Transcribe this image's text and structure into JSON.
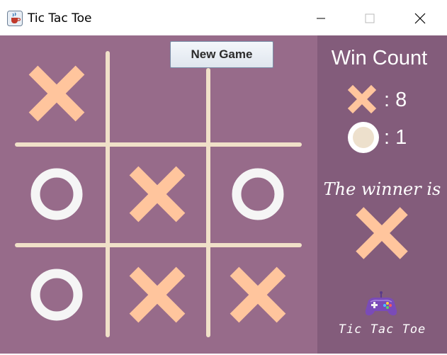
{
  "window": {
    "title": "Tic Tac Toe",
    "icon": "java-cup-icon"
  },
  "controls": {
    "new_game_label": "New Game"
  },
  "board": {
    "cells": [
      "X",
      "",
      "",
      "O",
      "X",
      "O",
      "O",
      "X",
      "X"
    ]
  },
  "sidebar": {
    "win_count_title": "Win Count",
    "scores": [
      {
        "player": "X",
        "value": ": 8"
      },
      {
        "player": "O",
        "value": ": 1"
      }
    ],
    "winner_label": "The winner is",
    "winner": "X",
    "footer": "Tic Tac Toe",
    "footer_icon": "gamepad-icon"
  },
  "colors": {
    "board_bg": "#976b8a",
    "sidebar_bg": "#835c7b",
    "x_mark": "#ffc59d",
    "o_mark": "#f5f5f5",
    "grid": "#f0e0c8"
  }
}
